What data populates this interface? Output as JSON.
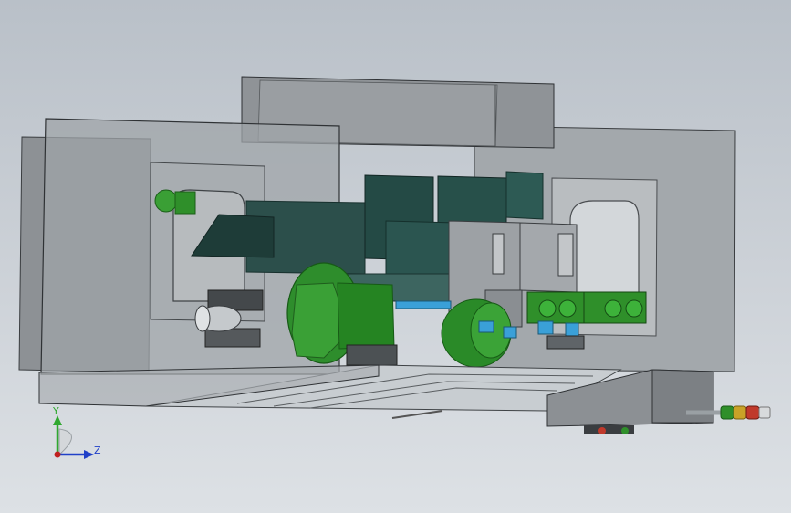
{
  "viewport": {
    "background_top": "#b9c0c8",
    "background_bottom": "#dde1e5"
  },
  "colors": {
    "housing_gray": "#8e9296",
    "dark_gray": "#5e6265",
    "teal_dark": "#1f4a45",
    "green": "#2f8f2a",
    "blue": "#3aa0d8",
    "red": "#c0392b"
  },
  "axis_triad": {
    "y_label": "Y",
    "z_label": "Z",
    "y_color": "#2fa82f",
    "z_color": "#2040c8",
    "origin_color": "#c02020"
  }
}
